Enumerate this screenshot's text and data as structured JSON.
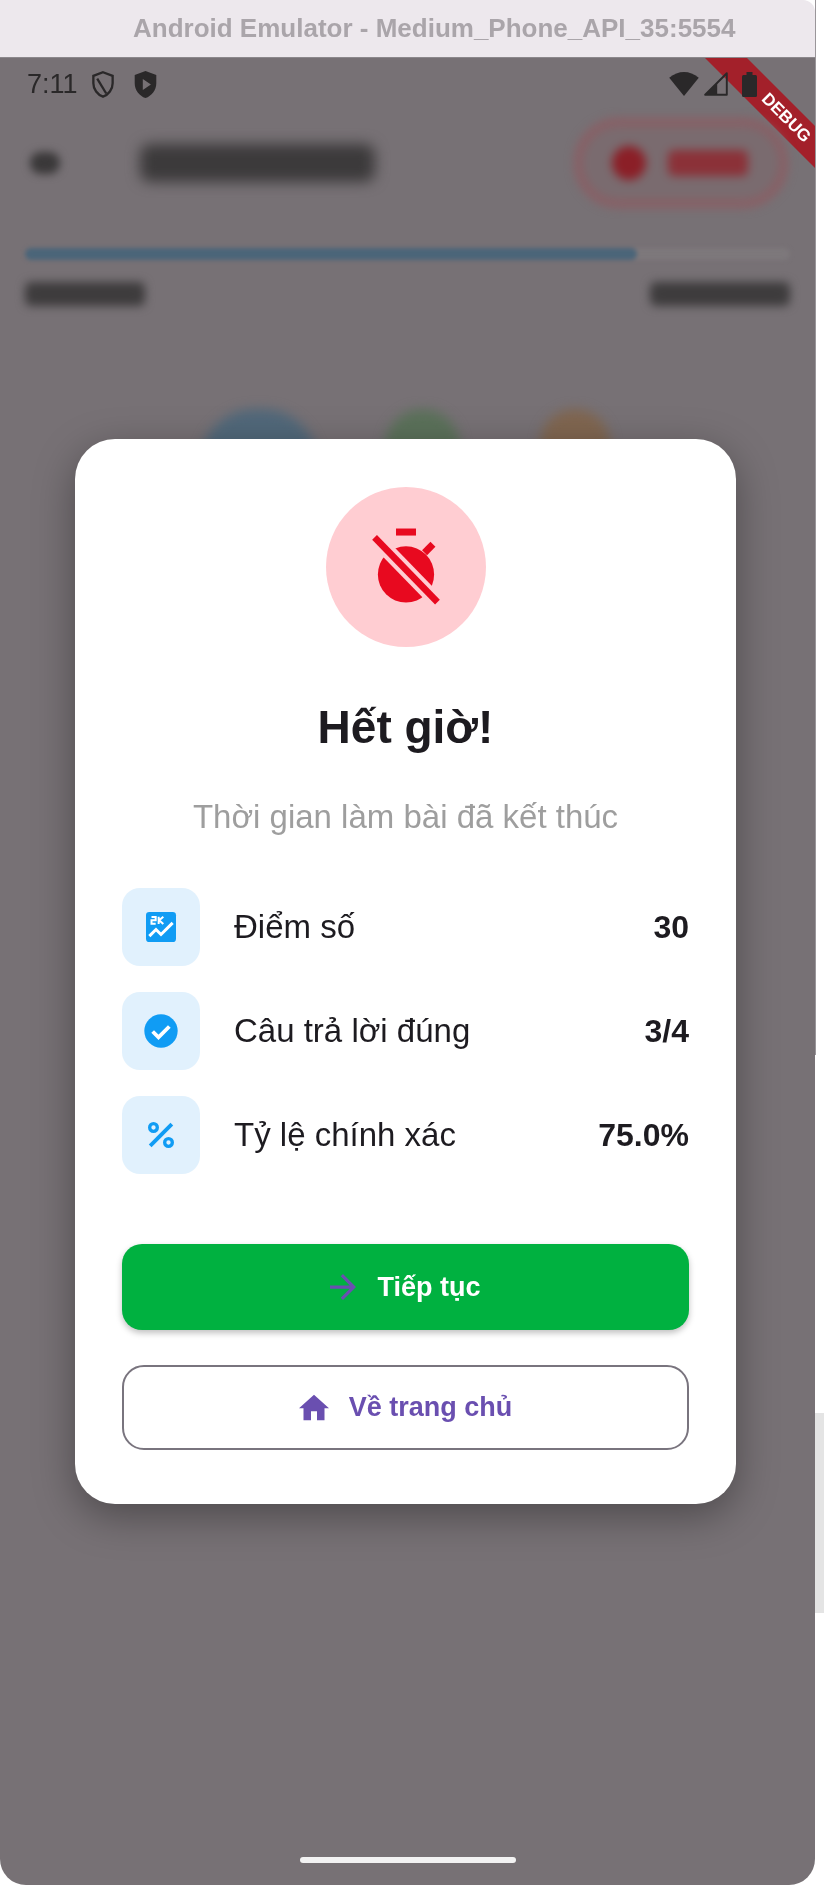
{
  "window": {
    "title": "Android Emulator - Medium_Phone_API_35:5554"
  },
  "status_bar": {
    "time": "7:11"
  },
  "debug_banner": "DEBUG",
  "background": {
    "progress": {
      "level": 0.8
    }
  },
  "dialog": {
    "title": "Hết giờ!",
    "message": "Thời gian làm bài đã kết thúc",
    "stats": [
      {
        "kind": "score",
        "label": "Điểm số",
        "value": "30"
      },
      {
        "kind": "correct",
        "label": "Câu trả lời đúng",
        "value": "3/4"
      },
      {
        "kind": "accuracy",
        "label": "Tỷ lệ chính xác",
        "value": "75.0%"
      }
    ],
    "buttons": [
      {
        "kind": "filled",
        "label": "Tiếp tục"
      },
      {
        "kind": "outlined",
        "label": "Về trang chủ"
      }
    ]
  }
}
